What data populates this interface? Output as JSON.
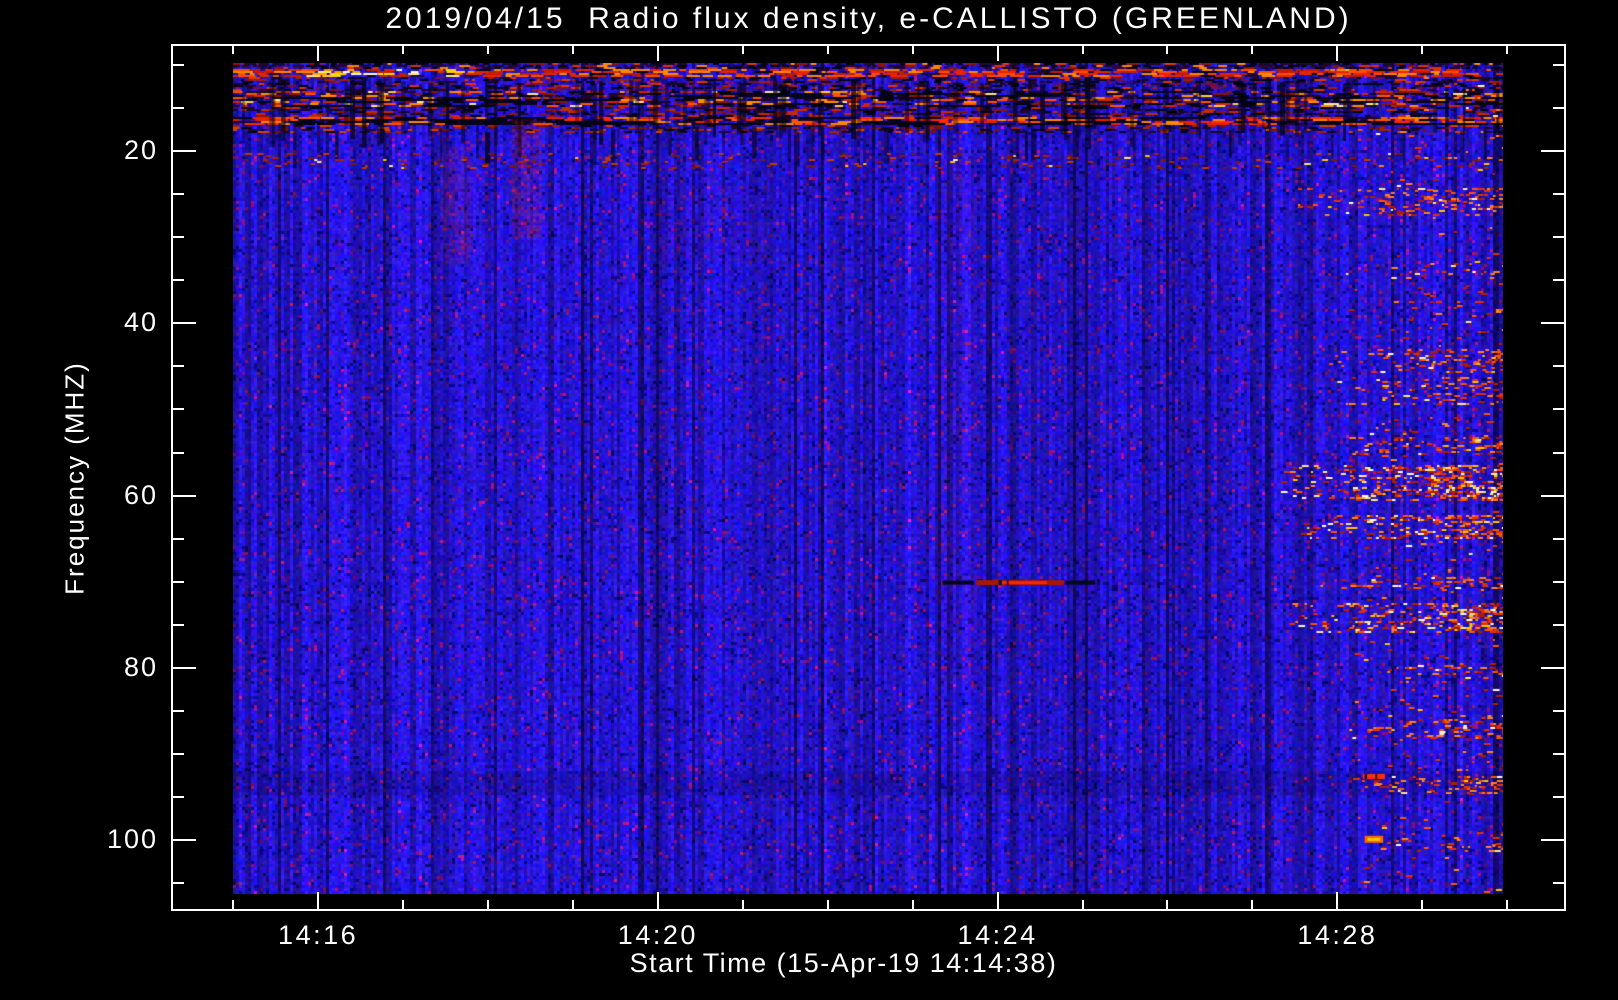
{
  "title": "2019/04/15  Radio flux density, e-CALLISTO (GREENLAND)",
  "colors": {
    "background": "#000000",
    "frame": "#ffffff",
    "text": "#ffffff",
    "base_blue": "#2222dd",
    "hot_red": "#ff2a00",
    "hot_orange": "#ff8800",
    "hot_yellow": "#ffd400"
  },
  "chart_data": {
    "type": "heatmap",
    "title": "2019/04/15  Radio flux density, e-CALLISTO (GREENLAND)",
    "xlabel": "Start Time (15-Apr-19 14:14:38)",
    "ylabel": "Frequency (MHZ)",
    "instrument": "e-CALLISTO (GREENLAND)",
    "date": "2019/04/15",
    "start_time": "14:14:38",
    "x_tick_labels": [
      "14:16",
      "14:20",
      "14:24",
      "14:28"
    ],
    "x_tick_values_min": [
      16,
      20,
      24,
      28
    ],
    "x_minor_step_min": 1,
    "x_minor_range_min": [
      15,
      30
    ],
    "x_axis_range_min": [
      14.28,
      30.68
    ],
    "x_data_range_min": [
      15.0,
      29.95
    ],
    "y_tick_values": [
      20,
      40,
      60,
      80,
      100
    ],
    "y_minor_step": 5,
    "y_minor_range": [
      10,
      105
    ],
    "y_axis_range": [
      7.7,
      108.1
    ],
    "y_data_range": [
      9.8,
      106.2
    ],
    "y_axis_inverted": true,
    "grid": false,
    "legend": false,
    "colormap": "CALLISTO quicklook blue-red-yellow",
    "background_color": "#2222dd",
    "description": "Dynamic radio spectrum: mostly quiet blue background; strong RFI bands at 10-17 MHz across all times; broadband RFI speckle bursts after ~14:27.5 near the right edge; short burst streak at ~70 MHz around 14:24; isolated bright points near 93 and 100 MHz at ~14:28.4",
    "features": [
      {
        "kind": "dash_band",
        "f": [
          9.8,
          10.45
        ],
        "t": [
          15.0,
          29.95
        ],
        "density": 0.3,
        "dash": [
          3,
          12
        ],
        "dark_prob": 0.5,
        "palette": [
          "#8f1300",
          "#d93700",
          "#ff8800",
          "#2a0530"
        ]
      },
      {
        "kind": "dash_band",
        "f": [
          10.45,
          11.35
        ],
        "t": [
          15.0,
          29.95
        ],
        "density": 0.72,
        "dash": [
          4,
          20
        ],
        "dark_prob": 0.14,
        "palette": [
          "#e62400",
          "#ff4c00",
          "#ff8800",
          "#c41b00"
        ],
        "hot": {
          "t": [
            15.8,
            17.6
          ],
          "prob": 0.5,
          "palette": [
            "#ffd400",
            "#ffee77",
            "#fffbd8",
            "#ffa200"
          ]
        }
      },
      {
        "kind": "dash_band",
        "f": [
          11.45,
          13.0
        ],
        "t": [
          15.0,
          29.95
        ],
        "density": 0.22,
        "dash": [
          3,
          12
        ],
        "dark_prob": 0.33,
        "palette": [
          "#a81c00",
          "#e23500",
          "#70123f"
        ]
      },
      {
        "kind": "dash_band",
        "f": [
          13.0,
          14.8
        ],
        "t": [
          15.0,
          29.95
        ],
        "density": 0.45,
        "dash": [
          4,
          16
        ],
        "dark_prob": 0.28,
        "long_dark": 0.05,
        "palette": [
          "#cf2700",
          "#ff5500",
          "#ff9100",
          "#8a1600"
        ],
        "hot": {
          "t": [
            15.0,
            29.95
          ],
          "prob": 0.04,
          "palette": [
            "#ffcf3e",
            "#ffe98c"
          ]
        }
      },
      {
        "kind": "dash_band",
        "f": [
          14.9,
          15.9
        ],
        "t": [
          15.0,
          29.95
        ],
        "density": 0.2,
        "dash": [
          4,
          14
        ],
        "dark_prob": 0.35,
        "palette": [
          "#8f1500",
          "#c52b00"
        ]
      },
      {
        "kind": "dash_band",
        "f": [
          16.0,
          16.95
        ],
        "t": [
          15.0,
          29.95
        ],
        "density": 0.6,
        "dash": [
          6,
          24
        ],
        "dark_prob": 0.28,
        "long_dark": 0.12,
        "palette": [
          "#ff2a00",
          "#e81f00",
          "#ff5500",
          "#ff8800"
        ]
      },
      {
        "kind": "dash_band",
        "f": [
          17.0,
          17.9
        ],
        "t": [
          15.0,
          29.95
        ],
        "density": 0.25,
        "dash": [
          3,
          12
        ],
        "dark_prob": 0.15,
        "palette": [
          "#a32300",
          "#d94000",
          "#7a1200"
        ]
      },
      {
        "kind": "dark_cols",
        "f": [
          11.4,
          19.8
        ],
        "t": [
          15.0,
          29.95
        ],
        "density": 0.2
      },
      {
        "kind": "dark_cols",
        "f": [
          17.0,
          22.0
        ],
        "t": [
          15.0,
          29.95
        ],
        "density": 0.08
      },
      {
        "kind": "speckle_band",
        "t": [
          15.0,
          29.95
        ],
        "f": [
          20.2,
          22.0
        ],
        "density": 0.06,
        "no_ramp": true,
        "palette": [
          "#79180a",
          "#a32300",
          "#c63800"
        ]
      },
      {
        "kind": "vplume",
        "t": [
          17.45,
          17.8
        ],
        "f": [
          19.5,
          33.0
        ],
        "alpha": 0.22
      },
      {
        "kind": "vplume",
        "t": [
          18.28,
          18.62
        ],
        "f": [
          16.5,
          30.0
        ],
        "alpha": 0.3
      },
      {
        "kind": "vplume",
        "t": [
          23.3,
          23.75
        ],
        "f": [
          20.0,
          82.0
        ],
        "alpha": 0.07
      },
      {
        "kind": "vplume",
        "t": [
          20.0,
          21.3
        ],
        "f": [
          24.0,
          33.0
        ],
        "alpha": 0.06
      },
      {
        "kind": "shade_band",
        "f": [
          92.0,
          94.8
        ],
        "alpha": 0.14
      },
      {
        "kind": "speckle_band",
        "t": [
          27.5,
          29.95
        ],
        "f": [
          24.3,
          27.6
        ],
        "density": 0.2
      },
      {
        "kind": "speckle_band",
        "t": [
          28.0,
          29.95
        ],
        "f": [
          33.0,
          34.8
        ],
        "density": 0.09
      },
      {
        "kind": "speckle_band",
        "t": [
          27.8,
          29.95
        ],
        "f": [
          43.0,
          45.6
        ],
        "density": 0.25
      },
      {
        "kind": "speckle_band",
        "t": [
          28.0,
          29.95
        ],
        "f": [
          46.2,
          49.5
        ],
        "density": 0.18
      },
      {
        "kind": "speckle_band",
        "t": [
          28.0,
          29.95
        ],
        "f": [
          53.2,
          55.3
        ],
        "density": 0.2
      },
      {
        "kind": "speckle_band",
        "t": [
          27.3,
          29.95
        ],
        "f": [
          56.4,
          60.5
        ],
        "density": 0.4,
        "bright": 0.3
      },
      {
        "kind": "speckle_band",
        "t": [
          27.5,
          29.95
        ],
        "f": [
          62.2,
          65.0
        ],
        "density": 0.38,
        "bright": 0.28
      },
      {
        "kind": "speckle_band",
        "t": [
          27.8,
          29.95
        ],
        "f": [
          69.4,
          70.8
        ],
        "density": 0.22
      },
      {
        "kind": "speckle_band",
        "t": [
          27.4,
          29.95
        ],
        "f": [
          72.5,
          75.9
        ],
        "density": 0.38,
        "bright": 0.3
      },
      {
        "kind": "speckle_band",
        "t": [
          28.2,
          29.95
        ],
        "f": [
          79.7,
          81.2
        ],
        "density": 0.14
      },
      {
        "kind": "speckle_band",
        "t": [
          28.0,
          29.95
        ],
        "f": [
          85.5,
          88.3
        ],
        "density": 0.16
      },
      {
        "kind": "speckle_band",
        "t": [
          27.9,
          29.95
        ],
        "f": [
          92.6,
          94.6
        ],
        "density": 0.26
      },
      {
        "kind": "speckle_band",
        "t": [
          28.3,
          29.95
        ],
        "f": [
          99.0,
          101.2
        ],
        "density": 0.12
      },
      {
        "kind": "speckle_band",
        "t": [
          28.1,
          29.95
        ],
        "f": [
          10.5,
          106.0
        ],
        "density": 0.03
      },
      {
        "kind": "streak",
        "f": 70.1,
        "t": [
          23.35,
          23.72
        ],
        "thickness": 4,
        "color": "#05051a"
      },
      {
        "kind": "streak",
        "f": 70.1,
        "t": [
          24.8,
          25.15
        ],
        "thickness": 4,
        "color": "#07071f"
      },
      {
        "kind": "streak",
        "f": 70.1,
        "t": [
          23.75,
          24.78
        ],
        "thickness": 5,
        "color": "#a81800",
        "core": {
          "t": [
            24.05,
            24.58
          ],
          "color": "#ff2600"
        }
      },
      {
        "kind": "streak",
        "f": 92.6,
        "t": [
          28.3,
          28.56
        ],
        "thickness": 5,
        "color": "#ff3000"
      },
      {
        "kind": "dot",
        "f": 99.9,
        "t": [
          28.32,
          28.54
        ],
        "thickness": 7,
        "color": "#ff6600",
        "core_color": "#ffc400"
      }
    ]
  }
}
